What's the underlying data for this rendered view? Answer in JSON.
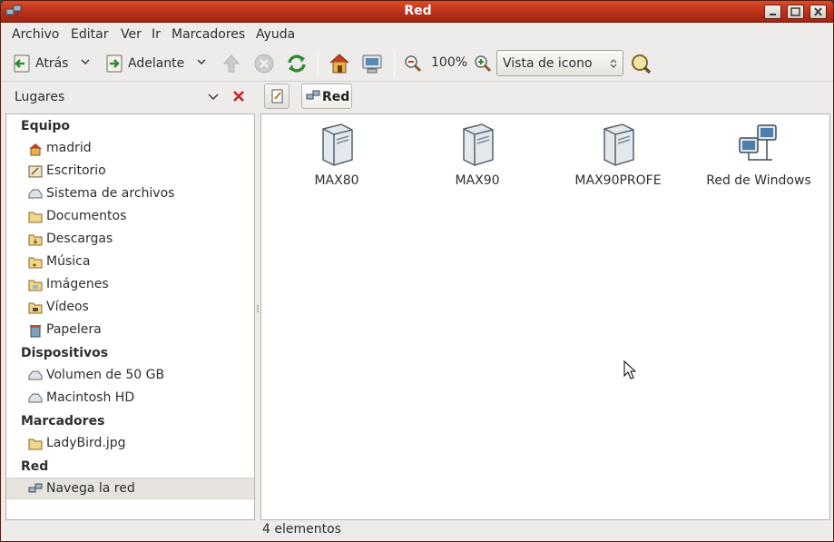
{
  "window": {
    "title": "Red"
  },
  "menu": [
    "Archivo",
    "Editar",
    "Ver",
    "Ir",
    "Marcadores",
    "Ayuda"
  ],
  "toolbar": {
    "back_label": "Atrás",
    "forward_label": "Adelante",
    "zoom_level": "100%",
    "view_mode": "Vista de icono"
  },
  "sidepane": {
    "title": "Lugares"
  },
  "pathbar": {
    "current": "Red"
  },
  "sidebar": {
    "sections": [
      {
        "label": "Equipo",
        "items": [
          {
            "label": "madrid",
            "icon": "home-folder-icon"
          },
          {
            "label": "Escritorio",
            "icon": "desktop-icon"
          },
          {
            "label": "Sistema de archivos",
            "icon": "filesystem-drive-icon"
          },
          {
            "label": "Documentos",
            "icon": "documents-folder-icon"
          },
          {
            "label": "Descargas",
            "icon": "downloads-folder-icon"
          },
          {
            "label": "Música",
            "icon": "music-folder-icon"
          },
          {
            "label": "Imágenes",
            "icon": "pictures-folder-icon"
          },
          {
            "label": "Vídeos",
            "icon": "videos-folder-icon"
          },
          {
            "label": "Papelera",
            "icon": "trash-icon"
          }
        ]
      },
      {
        "label": "Dispositivos",
        "items": [
          {
            "label": "Volumen de 50 GB",
            "icon": "drive-icon"
          },
          {
            "label": "Macintosh HD",
            "icon": "drive-icon"
          }
        ]
      },
      {
        "label": "Marcadores",
        "items": [
          {
            "label": "LadyBird.jpg",
            "icon": "folder-icon"
          }
        ]
      },
      {
        "label": "Red",
        "items": [
          {
            "label": "Navega la red",
            "icon": "network-icon",
            "selected": true
          }
        ]
      }
    ]
  },
  "content": {
    "items": [
      {
        "label": "MAX80",
        "icon": "server-icon"
      },
      {
        "label": "MAX90",
        "icon": "server-icon"
      },
      {
        "label": "MAX90PROFE",
        "icon": "server-icon"
      },
      {
        "label": "Red de Windows",
        "icon": "windows-network-icon"
      }
    ]
  },
  "status": {
    "text": "4 elementos"
  },
  "colors": {
    "titlebar": "#c13a1f",
    "selection": "#e6e3df",
    "window_bg": "#edeceb"
  }
}
